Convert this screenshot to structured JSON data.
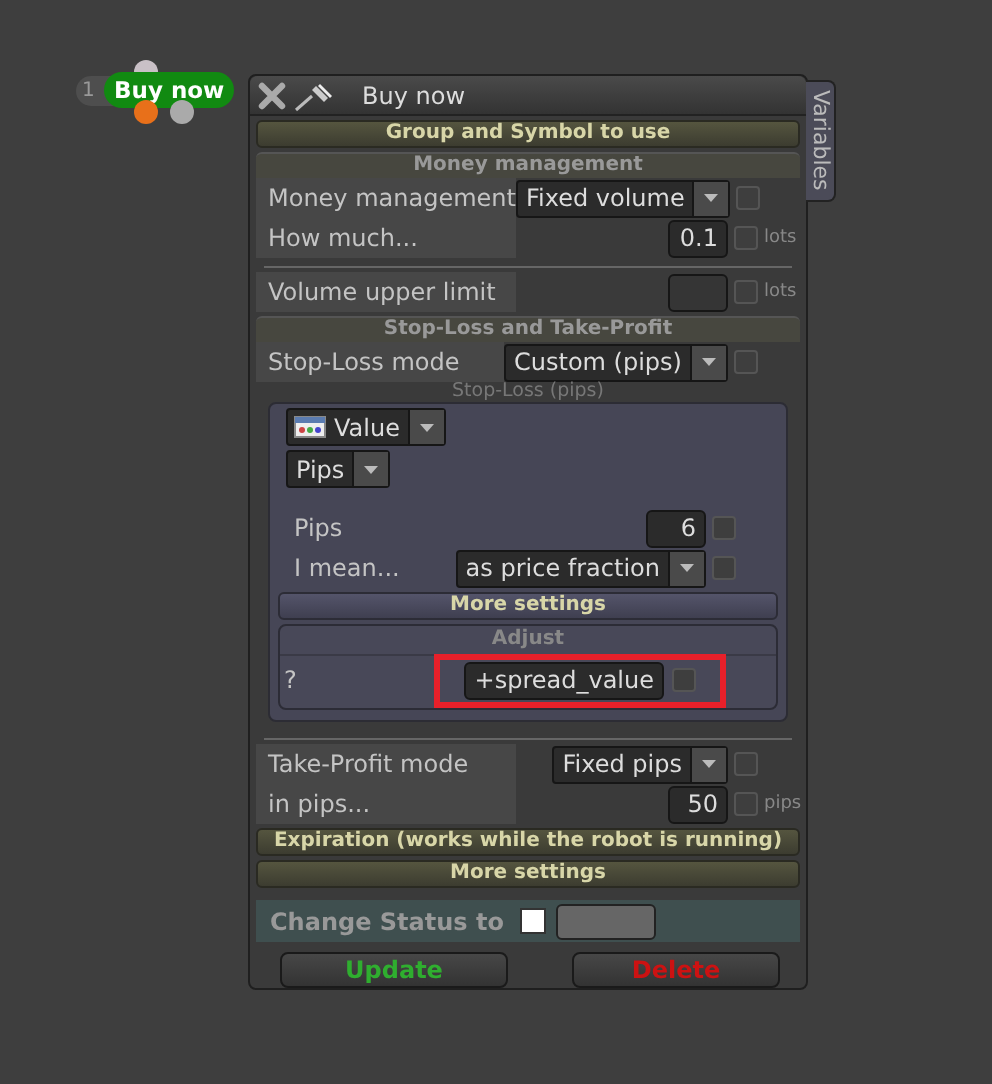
{
  "node": {
    "number": "1",
    "label": "Buy now"
  },
  "window": {
    "title": "Buy now",
    "side_tab": "Variables"
  },
  "items": [
    {
      "kind": "header",
      "text": "Group and Symbol to use"
    },
    {
      "kind": "subheader",
      "text": "Money management"
    },
    {
      "kind": "row",
      "label": "Money management",
      "control": {
        "kind": "dropdown",
        "value": "Fixed volume"
      },
      "checkbox": {
        "checked": false
      }
    },
    {
      "kind": "row",
      "label": "How much...",
      "control": {
        "kind": "number",
        "value": "0.1"
      },
      "checkbox": {
        "checked": false
      },
      "unit": "lots"
    },
    {
      "kind": "divider"
    },
    {
      "kind": "row",
      "label": "Volume upper limit",
      "control": {
        "kind": "number"
      },
      "checkbox": {
        "checked": false
      },
      "unit": "lots"
    },
    {
      "kind": "subheader",
      "text": "Stop-Loss and Take-Profit"
    },
    {
      "kind": "row",
      "label": "Stop-Loss mode",
      "control": {
        "kind": "dropdown",
        "value": "Custom (pips)"
      },
      "checkbox": {
        "checked": false
      }
    },
    {
      "kind": "caption",
      "text": "Stop-Loss (pips)"
    },
    {
      "kind": "panel",
      "children": [
        {
          "kind": "icon_selector",
          "value": "Value"
        },
        {
          "kind": "selector",
          "value": "Pips"
        },
        {
          "kind": "spacer"
        },
        {
          "kind": "row",
          "label": "Pips",
          "control": {
            "kind": "number",
            "value": "6"
          },
          "checkbox": {
            "checked": false
          }
        },
        {
          "kind": "row",
          "label": "I mean...",
          "control": {
            "kind": "dropdown",
            "value": "as price fraction"
          },
          "checkbox": {
            "checked": false
          }
        },
        {
          "kind": "header",
          "text": "More settings"
        },
        {
          "kind": "group",
          "title": "Adjust",
          "children": [
            {
              "kind": "row",
              "label": "?",
              "control": {
                "kind": "number",
                "value": "+spread_value",
                "highlighted": true
              },
              "checkbox": {
                "checked": false
              }
            }
          ]
        }
      ]
    },
    {
      "kind": "divider"
    },
    {
      "kind": "row",
      "label": "Take-Profit mode",
      "control": {
        "kind": "dropdown",
        "value": "Fixed pips"
      },
      "checkbox": {
        "checked": false
      }
    },
    {
      "kind": "row",
      "label": "in pips...",
      "control": {
        "kind": "number",
        "value": "50"
      },
      "checkbox": {
        "checked": false
      },
      "unit": "pips"
    },
    {
      "kind": "header",
      "text": "Expiration (works while the robot is running)"
    },
    {
      "kind": "header",
      "text": "More settings"
    }
  ],
  "status": {
    "label": "Change Status to",
    "checkbox": {
      "checked": false
    }
  },
  "buttons": [
    {
      "label": "Update",
      "kind": "confirm"
    },
    {
      "label": "Delete",
      "kind": "danger"
    }
  ]
}
